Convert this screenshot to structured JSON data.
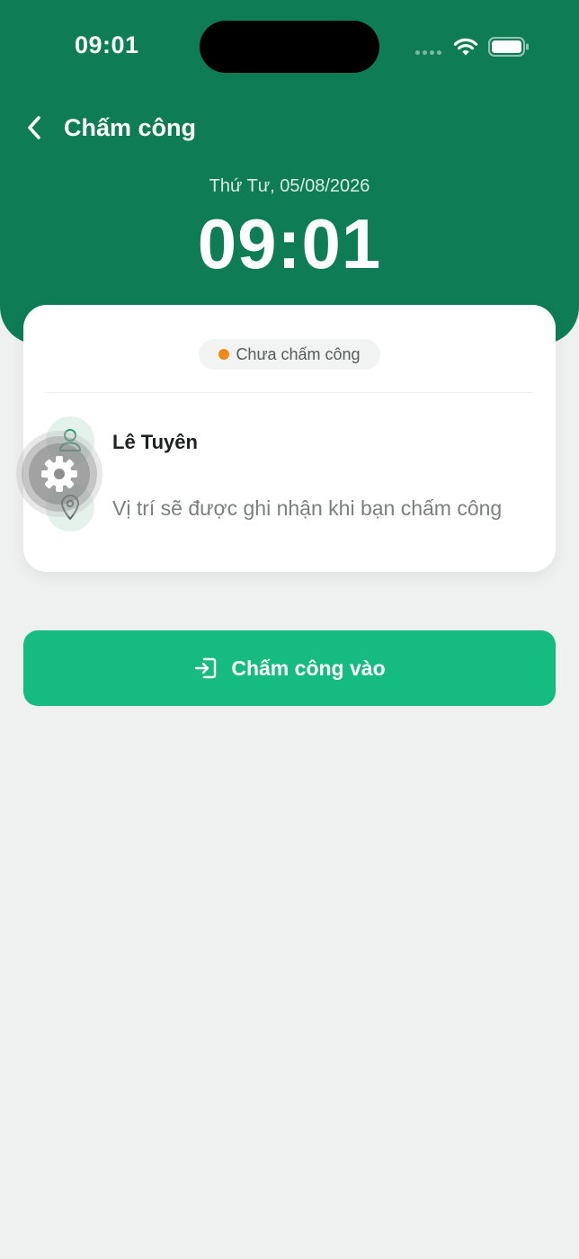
{
  "colors": {
    "header_bg": "#0e7d56",
    "accent_button": "#15bb80",
    "status_dot": "#ef8a16",
    "page_bg": "#eef1f0"
  },
  "status_bar": {
    "time": "09:01"
  },
  "nav": {
    "title": "Chấm công",
    "back_icon": "chevron-left-icon"
  },
  "clock": {
    "date": "Thứ Tư, 05/08/2026",
    "time": "09:01"
  },
  "card": {
    "status_badge": "Chưa chấm công",
    "user_name": "Lê Tuyên",
    "location_note": "Vị trí sẽ được ghi nhận khi bạn chấm công"
  },
  "checkin_button": {
    "label": "Chấm công vào",
    "icon": "login-icon"
  },
  "floating": {
    "icon": "gear-icon"
  }
}
